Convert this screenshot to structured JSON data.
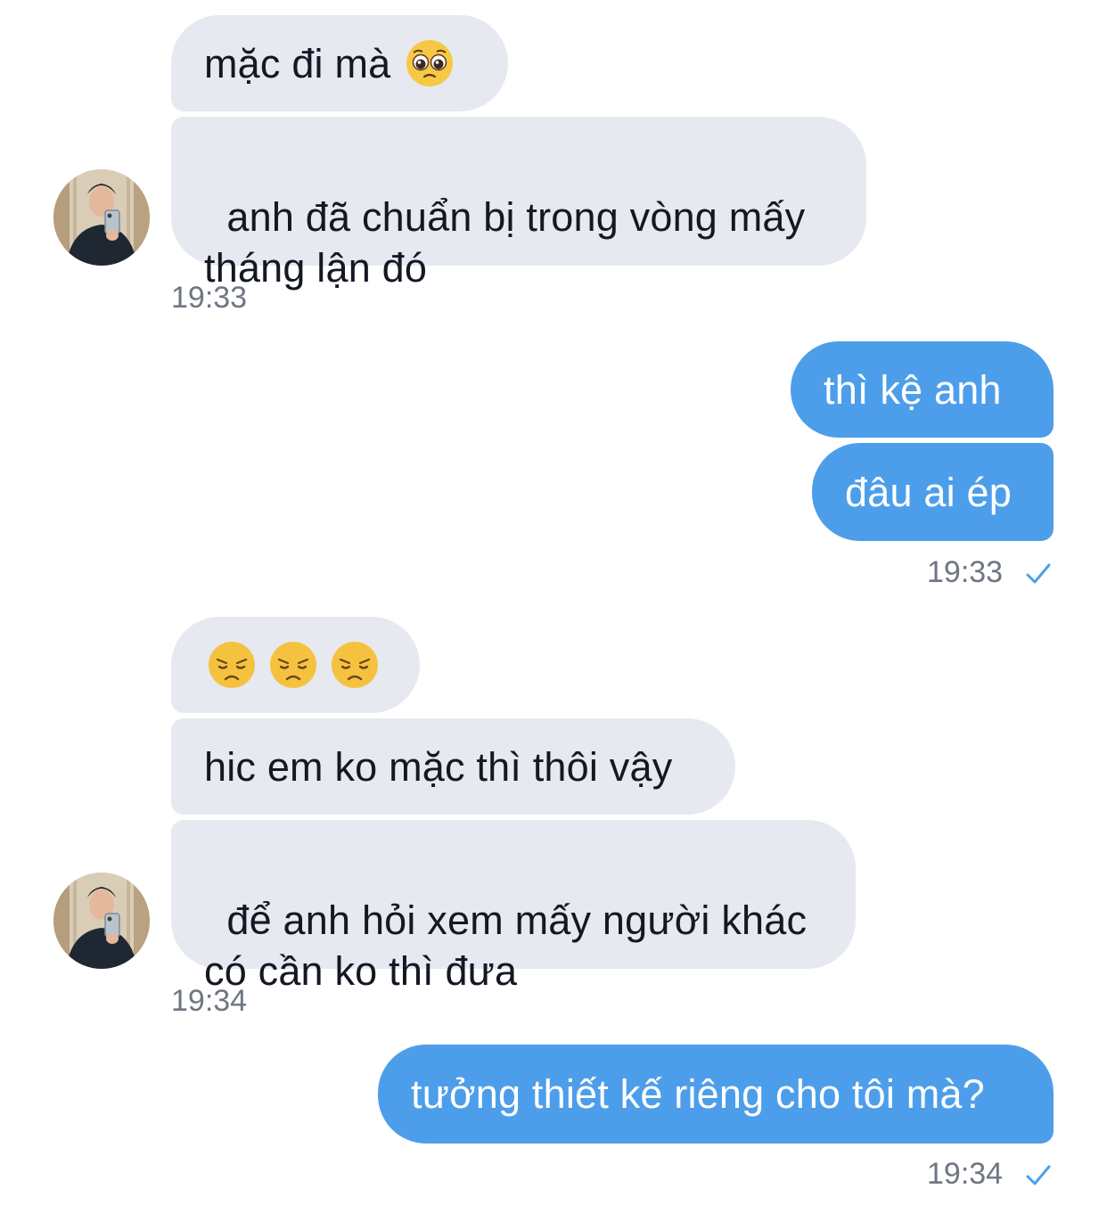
{
  "messages": [
    {
      "side": "in",
      "text": "mặc đi mà",
      "emoji": "pleading-face"
    },
    {
      "side": "in",
      "text": "anh đã chuẩn bị trong vòng mấy\ntháng lận đó"
    },
    {
      "side": "in",
      "time": "19:33"
    },
    {
      "side": "out",
      "text": "thì kệ anh"
    },
    {
      "side": "out",
      "text": "đâu ai ép"
    },
    {
      "side": "out",
      "time": "19:33",
      "status": "sent"
    },
    {
      "side": "in",
      "emoji": [
        "disappointed-face",
        "disappointed-face",
        "disappointed-face"
      ]
    },
    {
      "side": "in",
      "text": "hic em ko mặc thì thôi vậy"
    },
    {
      "side": "in",
      "text": "để anh hỏi xem mấy người khác\ncó cần ko thì đưa"
    },
    {
      "side": "in",
      "time": "19:34"
    },
    {
      "side": "out",
      "text": "tưởng thiết kế riêng cho tôi mà?"
    },
    {
      "side": "out",
      "time": "19:34",
      "status": "sent"
    }
  ],
  "icons": {
    "check": "check-icon",
    "avatar": "contact-avatar"
  },
  "colors": {
    "incoming_bubble": "#e6e9ef",
    "outgoing_bubble": "#4d9eea",
    "timestamp": "#6f7682",
    "check": "#4d9eea"
  }
}
